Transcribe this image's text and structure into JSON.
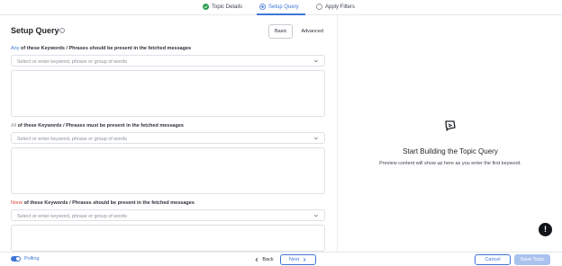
{
  "stepper": {
    "steps": [
      {
        "label": "Topic Details",
        "state": "completed"
      },
      {
        "label": "Setup Query",
        "state": "active"
      },
      {
        "label": "Apply Filters",
        "state": "pending"
      }
    ]
  },
  "header": {
    "title": "Setup Query",
    "info_icon": "info-icon",
    "modes": {
      "basic": "Basic",
      "advanced": "Advanced",
      "selected": "Basic"
    }
  },
  "sections": [
    {
      "lead": "Any",
      "rest": " of these Keywords / Phrases should be present in the fetched messages",
      "placeholder": "Select or enter keyword, phrase or group of words"
    },
    {
      "lead": "All",
      "rest": " of these Keywords / Phrases must be present in the fetched messages",
      "placeholder": "Select or enter keyword, phrase or group of words"
    },
    {
      "lead": "None",
      "rest": " of these Keywords / Phrases should be present in the fetched messages",
      "placeholder": "Select or enter keyword, phrase or group of words"
    }
  ],
  "preview": {
    "title": "Start Building the Topic Query",
    "subtitle": "Preview content will show up here as you enter the first keyword.",
    "alert_icon": "!"
  },
  "footer": {
    "polling_label": "Polling",
    "polling_on": true,
    "back_label": "Back",
    "next_label": "Next",
    "cancel_label": "Cancel",
    "save_label": "Save Topic"
  },
  "colors": {
    "accent": "#3f76d6",
    "none_red": "#d6453d",
    "disabled_blue": "#a9c2ee"
  }
}
